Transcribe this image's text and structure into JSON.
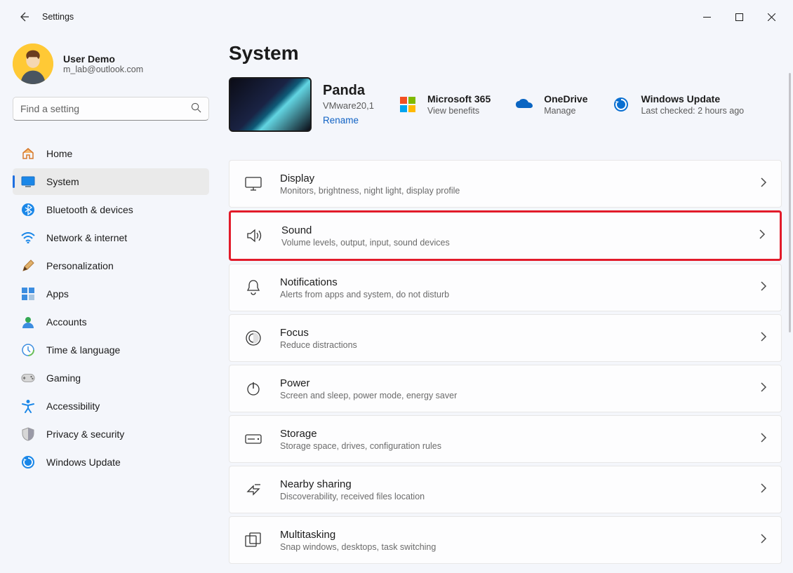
{
  "window": {
    "title": "Settings"
  },
  "profile": {
    "name": "User Demo",
    "email": "m_lab@outlook.com"
  },
  "search": {
    "placeholder": "Find a setting"
  },
  "nav": [
    {
      "id": "home",
      "label": "Home"
    },
    {
      "id": "system",
      "label": "System",
      "selected": true
    },
    {
      "id": "bluetooth",
      "label": "Bluetooth & devices"
    },
    {
      "id": "network",
      "label": "Network & internet"
    },
    {
      "id": "personalization",
      "label": "Personalization"
    },
    {
      "id": "apps",
      "label": "Apps"
    },
    {
      "id": "accounts",
      "label": "Accounts"
    },
    {
      "id": "time",
      "label": "Time & language"
    },
    {
      "id": "gaming",
      "label": "Gaming"
    },
    {
      "id": "accessibility",
      "label": "Accessibility"
    },
    {
      "id": "privacy",
      "label": "Privacy & security"
    },
    {
      "id": "update",
      "label": "Windows Update"
    }
  ],
  "page": {
    "heading": "System",
    "pc": {
      "name": "Panda",
      "model": "VMware20,1",
      "rename": "Rename"
    },
    "quick": [
      {
        "id": "m365",
        "title": "Microsoft 365",
        "sub": "View benefits"
      },
      {
        "id": "onedrive",
        "title": "OneDrive",
        "sub": "Manage"
      },
      {
        "id": "winupdate",
        "title": "Windows Update",
        "sub": "Last checked: 2 hours ago"
      }
    ],
    "rows": [
      {
        "id": "display",
        "title": "Display",
        "sub": "Monitors, brightness, night light, display profile"
      },
      {
        "id": "sound",
        "title": "Sound",
        "sub": "Volume levels, output, input, sound devices",
        "highlight": true
      },
      {
        "id": "notifications",
        "title": "Notifications",
        "sub": "Alerts from apps and system, do not disturb"
      },
      {
        "id": "focus",
        "title": "Focus",
        "sub": "Reduce distractions"
      },
      {
        "id": "power",
        "title": "Power",
        "sub": "Screen and sleep, power mode, energy saver"
      },
      {
        "id": "storage",
        "title": "Storage",
        "sub": "Storage space, drives, configuration rules"
      },
      {
        "id": "nearby",
        "title": "Nearby sharing",
        "sub": "Discoverability, received files location"
      },
      {
        "id": "multitasking",
        "title": "Multitasking",
        "sub": "Snap windows, desktops, task switching"
      }
    ]
  }
}
